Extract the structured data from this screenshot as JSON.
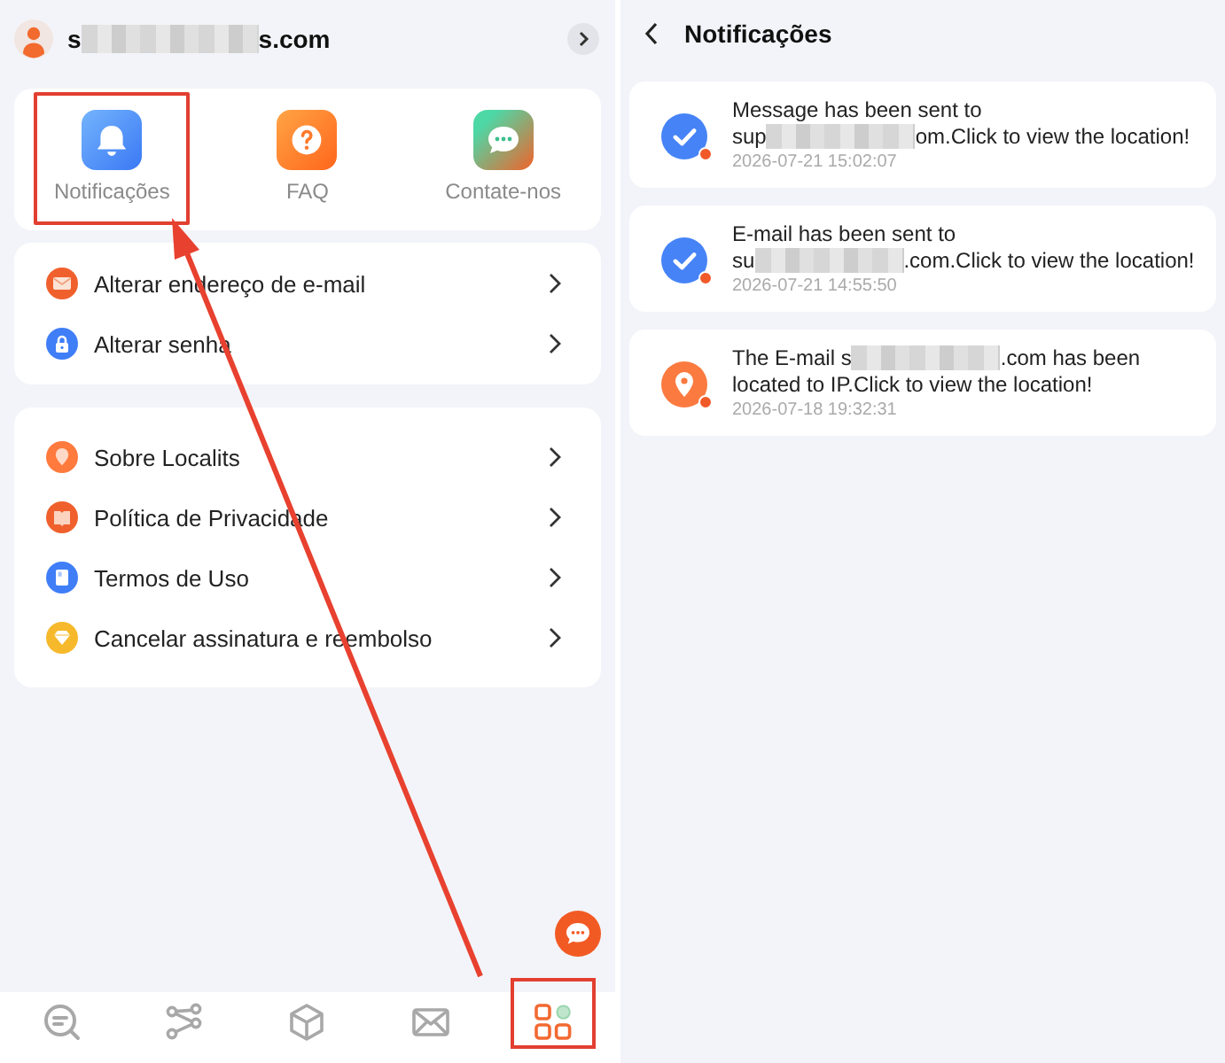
{
  "account": {
    "email_start": "s",
    "email_end": "s.com"
  },
  "quick_actions": [
    {
      "label": "Notificações",
      "highlighted": true
    },
    {
      "label": "FAQ",
      "highlighted": false
    },
    {
      "label": "Contate-nos",
      "highlighted": false
    }
  ],
  "account_menu": [
    {
      "label": "Alterar endereço de e-mail"
    },
    {
      "label": "Alterar senha"
    }
  ],
  "info_menu": [
    {
      "label": "Sobre Localits"
    },
    {
      "label": "Política de Privacidade"
    },
    {
      "label": "Termos de Uso"
    },
    {
      "label": "Cancelar assinatura e reembolso"
    }
  ],
  "bottom_nav": [
    {
      "selected": false,
      "highlighted": false
    },
    {
      "selected": false,
      "highlighted": false
    },
    {
      "selected": false,
      "highlighted": false
    },
    {
      "selected": false,
      "highlighted": false
    },
    {
      "selected": true,
      "highlighted": true
    }
  ],
  "annotation_arrow": true,
  "notifications_screen": {
    "title": "Notificações",
    "notifications": [
      {
        "kind": "sent",
        "unread": true,
        "message_before": "Message has been sent to sup",
        "message_after": "om.Click to view the location!",
        "time": "2026-07-21 15:02:07"
      },
      {
        "kind": "sent",
        "unread": true,
        "message_before": "E-mail has been sent to su",
        "message_after": ".com.Click to view the location!",
        "time": "2026-07-21 14:55:50"
      },
      {
        "kind": "located",
        "unread": true,
        "message_before": "The E-mail s",
        "message_after": ".com has been located to IP.Click to view the location!",
        "time": "2026-07-18 19:32:31"
      }
    ]
  }
}
